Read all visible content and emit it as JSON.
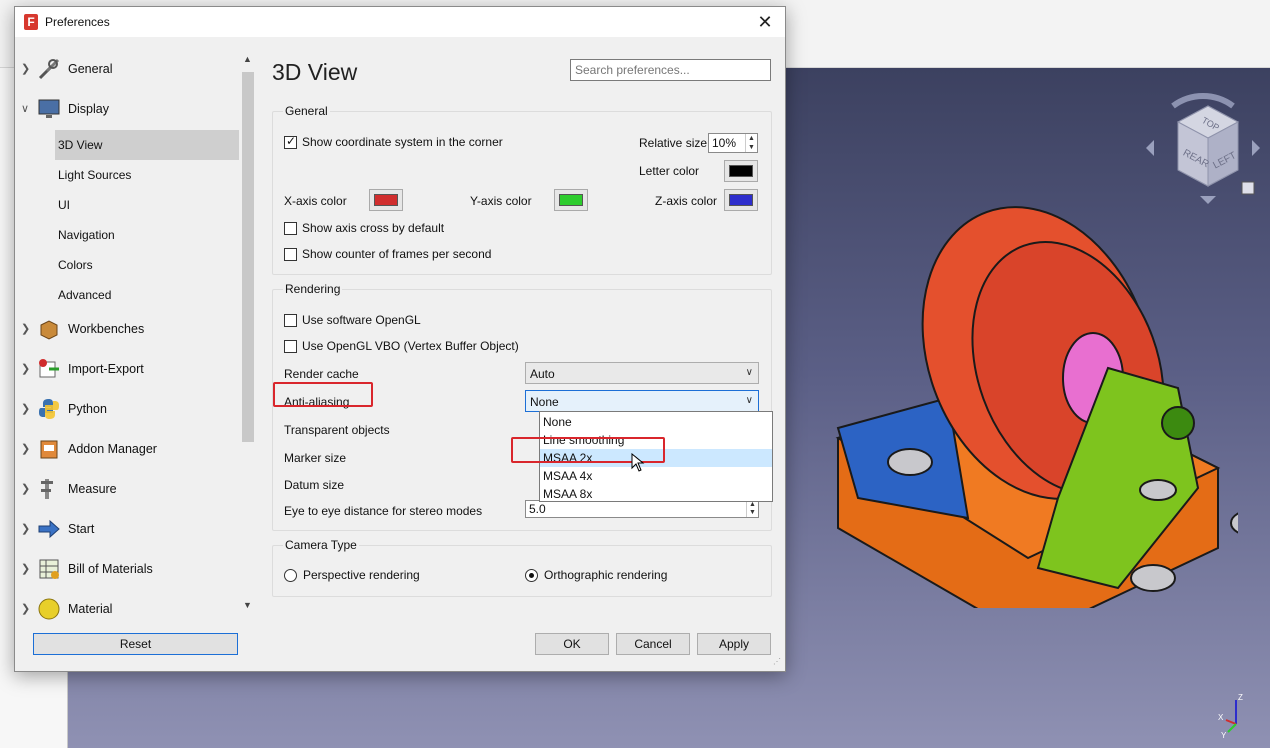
{
  "dialog": {
    "title": "Preferences",
    "close_symbol": "✕"
  },
  "tree": {
    "items": [
      {
        "label": "General",
        "icon": "wrench-screwdriver-icon"
      },
      {
        "label": "Display",
        "icon": "monitor-icon",
        "expanded": true
      },
      {
        "label": "Workbenches",
        "icon": "box-icon"
      },
      {
        "label": "Import-Export",
        "icon": "import-export-icon"
      },
      {
        "label": "Python",
        "icon": "python-icon"
      },
      {
        "label": "Addon Manager",
        "icon": "addon-manager-icon"
      },
      {
        "label": "Measure",
        "icon": "caliper-icon"
      },
      {
        "label": "Start",
        "icon": "arrow-right-icon"
      },
      {
        "label": "Bill of Materials",
        "icon": "spreadsheet-icon"
      },
      {
        "label": "Material",
        "icon": "sphere-icon"
      }
    ],
    "display_children": [
      "3D View",
      "Light Sources",
      "UI",
      "Navigation",
      "Colors",
      "Advanced"
    ],
    "selected": "3D View",
    "reset_label": "Reset"
  },
  "page": {
    "title": "3D View",
    "search_placeholder": "Search preferences..."
  },
  "general": {
    "title": "General",
    "show_coord_system": {
      "label": "Show coordinate system in the corner",
      "checked": true
    },
    "relative_size": {
      "label": "Relative size",
      "value": "10%"
    },
    "letter_color": {
      "label": "Letter color",
      "color": "#000000"
    },
    "x_axis": {
      "label": "X-axis color",
      "color": "#d02d2d"
    },
    "y_axis": {
      "label": "Y-axis color",
      "color": "#2dcc2d"
    },
    "z_axis": {
      "label": "Z-axis color",
      "color": "#2d2dcc"
    },
    "show_axis_cross": {
      "label": "Show axis cross by default",
      "checked": false
    },
    "show_fps": {
      "label": "Show counter of frames per second",
      "checked": false
    }
  },
  "rendering": {
    "title": "Rendering",
    "software_opengl": {
      "label": "Use software OpenGL",
      "checked": false
    },
    "opengl_vbo": {
      "label": "Use OpenGL VBO (Vertex Buffer Object)",
      "checked": false
    },
    "render_cache": {
      "label": "Render cache",
      "value": "Auto"
    },
    "anti_aliasing": {
      "label": "Anti-aliasing",
      "value": "None"
    },
    "transparent_objects": {
      "label": "Transparent objects"
    },
    "marker_size": {
      "label": "Marker size"
    },
    "datum_size": {
      "label": "Datum size"
    },
    "eye_distance": {
      "label": "Eye to eye distance for stereo modes",
      "value": "5.0"
    },
    "dropdown_options": [
      "None",
      "Line smoothing",
      "MSAA 2x",
      "MSAA 4x",
      "MSAA 8x"
    ],
    "hovered_option": "MSAA 2x"
  },
  "camera": {
    "title": "Camera Type",
    "perspective": {
      "label": "Perspective rendering",
      "selected": false
    },
    "orthographic": {
      "label": "Orthographic rendering",
      "selected": true
    }
  },
  "buttons": {
    "ok": "OK",
    "cancel": "Cancel",
    "apply": "Apply"
  },
  "navcube": {
    "face_top": "TOP",
    "face_rear": "REAR",
    "face_left": "LEFT"
  },
  "axis_indicator": {
    "z": "Z",
    "x": "X",
    "y": "Y"
  },
  "colors": {
    "accent": "#1c6fd6",
    "highlight": "#d9262c",
    "selected_row": "#cfcfcf"
  }
}
